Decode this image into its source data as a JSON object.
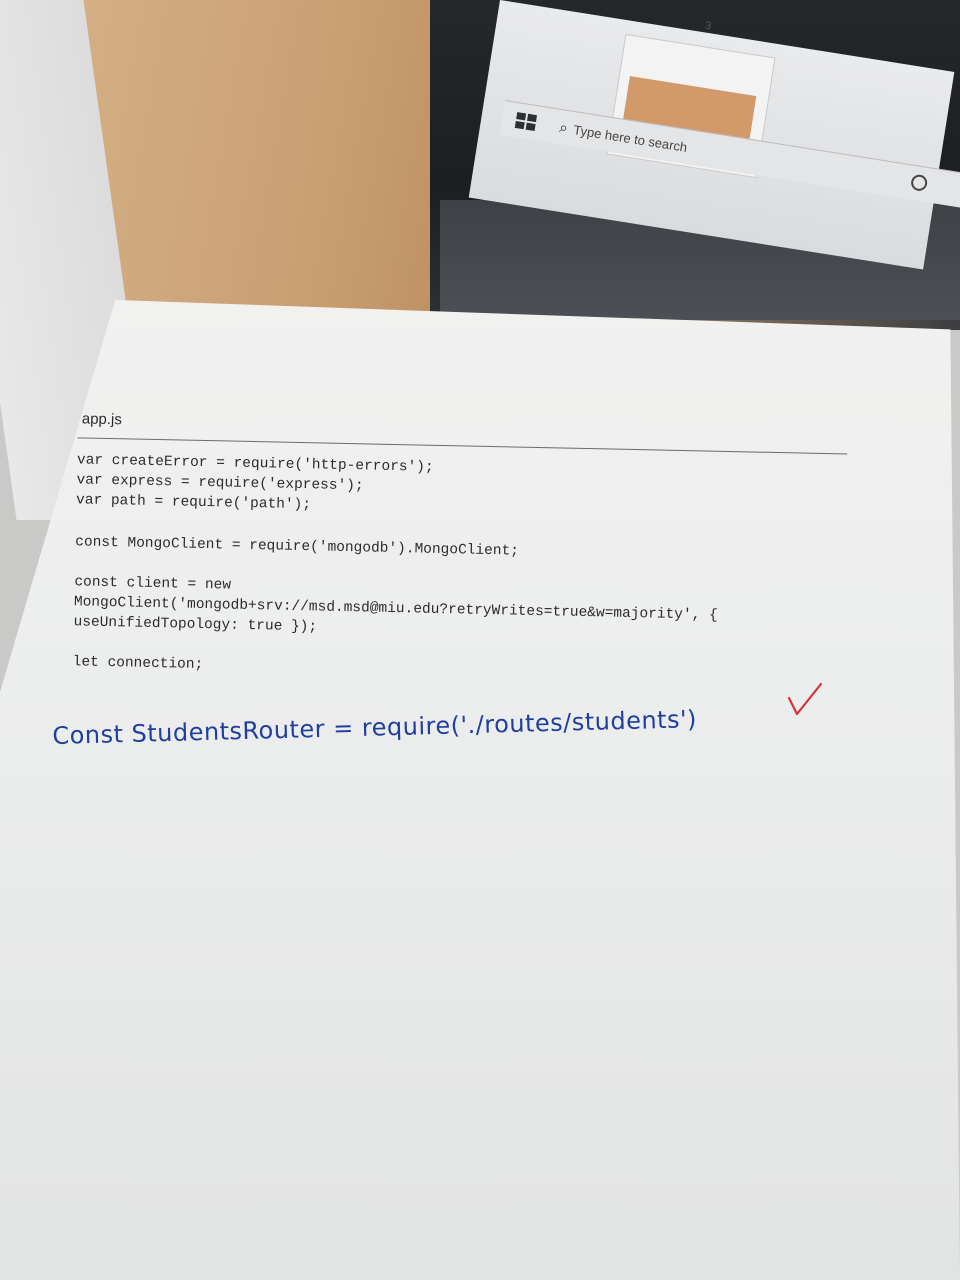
{
  "background": {
    "taskbar": {
      "search_placeholder": "Type here to search"
    },
    "thumbnail_number": "3"
  },
  "document": {
    "file_title": "app.js",
    "code_lines": [
      "var createError = require('http-errors');",
      "var express = require('express');",
      "var path = require('path');",
      "const MongoClient = require('mongodb').MongoClient;",
      "const client = new",
      "MongoClient('mongodb+srv://msd.msd@miu.edu?retryWrites=true&w=majority', {",
      "useUnifiedTopology: true });",
      "let connection;"
    ],
    "handwritten_line": "Const StudentsRouter = require('./routes/students')"
  },
  "colors": {
    "ink_blue": "#1f3f9e",
    "check_red": "#d6323a"
  }
}
